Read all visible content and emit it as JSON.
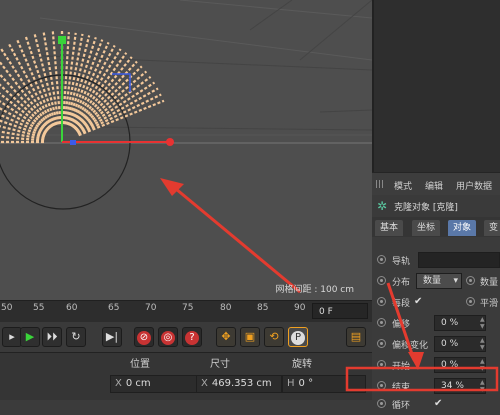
{
  "viewport": {
    "grid_label": "网格间距 : 100 cm",
    "colors": {
      "background": "#4e4e4e",
      "clone_bars": "#f3c89a",
      "arrow": "#e33b2f"
    }
  },
  "timeline": {
    "ticks": [
      "50",
      "55",
      "60",
      "65",
      "70",
      "75",
      "80",
      "85",
      "90",
      "9"
    ],
    "frame": "0 F"
  },
  "controls": {
    "items": [
      {
        "name": "go-to-end-button",
        "icon": "skip-end-icon",
        "glyph": "▸|"
      },
      {
        "name": "play-button",
        "icon": "play-icon",
        "glyph": "▶"
      },
      {
        "name": "next-frame-button",
        "icon": "next-frame-icon",
        "glyph": "▸▸"
      },
      {
        "name": "loop-button",
        "icon": "loop-icon",
        "glyph": "↻"
      },
      {
        "name": "go-to-end-frame-button",
        "icon": "end-frame-icon",
        "glyph": "▶|"
      },
      {
        "name": "record-keys-button",
        "icon": "record-icon",
        "glyph": "●"
      },
      {
        "name": "auto-key-button",
        "icon": "auto-key-icon",
        "glyph": "◉"
      },
      {
        "name": "help-key-button",
        "icon": "question-icon",
        "glyph": "?"
      },
      {
        "name": "move-tool-button",
        "icon": "move-icon",
        "glyph": "✥"
      },
      {
        "name": "scale-tool-button",
        "icon": "scale-icon",
        "glyph": "▣"
      },
      {
        "name": "rotate-tool-button",
        "icon": "rotate-icon",
        "glyph": "⟲"
      },
      {
        "name": "parameter-button",
        "icon": "p-icon",
        "glyph": "P"
      },
      {
        "name": "timeline-button",
        "icon": "timeline-icon",
        "glyph": "▤"
      }
    ]
  },
  "coords": {
    "headers": {
      "position": "位置",
      "size": "尺寸",
      "rotation": "旋转"
    },
    "row": {
      "axis_x": "X",
      "x_value": "0 cm",
      "size_axis": "X",
      "size_value": "469.353 cm",
      "rot_axis": "H",
      "rot_value": "0 °"
    }
  },
  "panel": {
    "menu": [
      "模式",
      "编辑",
      "用户数据"
    ],
    "object_title": "克隆对象 [克隆]",
    "tabs": [
      "基本",
      "坐标",
      "对象",
      "变"
    ],
    "active_tab": 2,
    "rows": [
      {
        "label": "导轨",
        "value": ""
      },
      {
        "label": "分布",
        "value": "数量",
        "extra": "数量"
      },
      {
        "label": "每段",
        "check": "✔",
        "extra": "平滑"
      },
      {
        "label": "偏移",
        "value": "0 %"
      },
      {
        "label": "偏移变化",
        "value": "0 %"
      },
      {
        "label": "开始",
        "value": "0 %"
      },
      {
        "label": "结束",
        "value": "34 %"
      },
      {
        "label": "循环",
        "check": "✔"
      }
    ]
  }
}
